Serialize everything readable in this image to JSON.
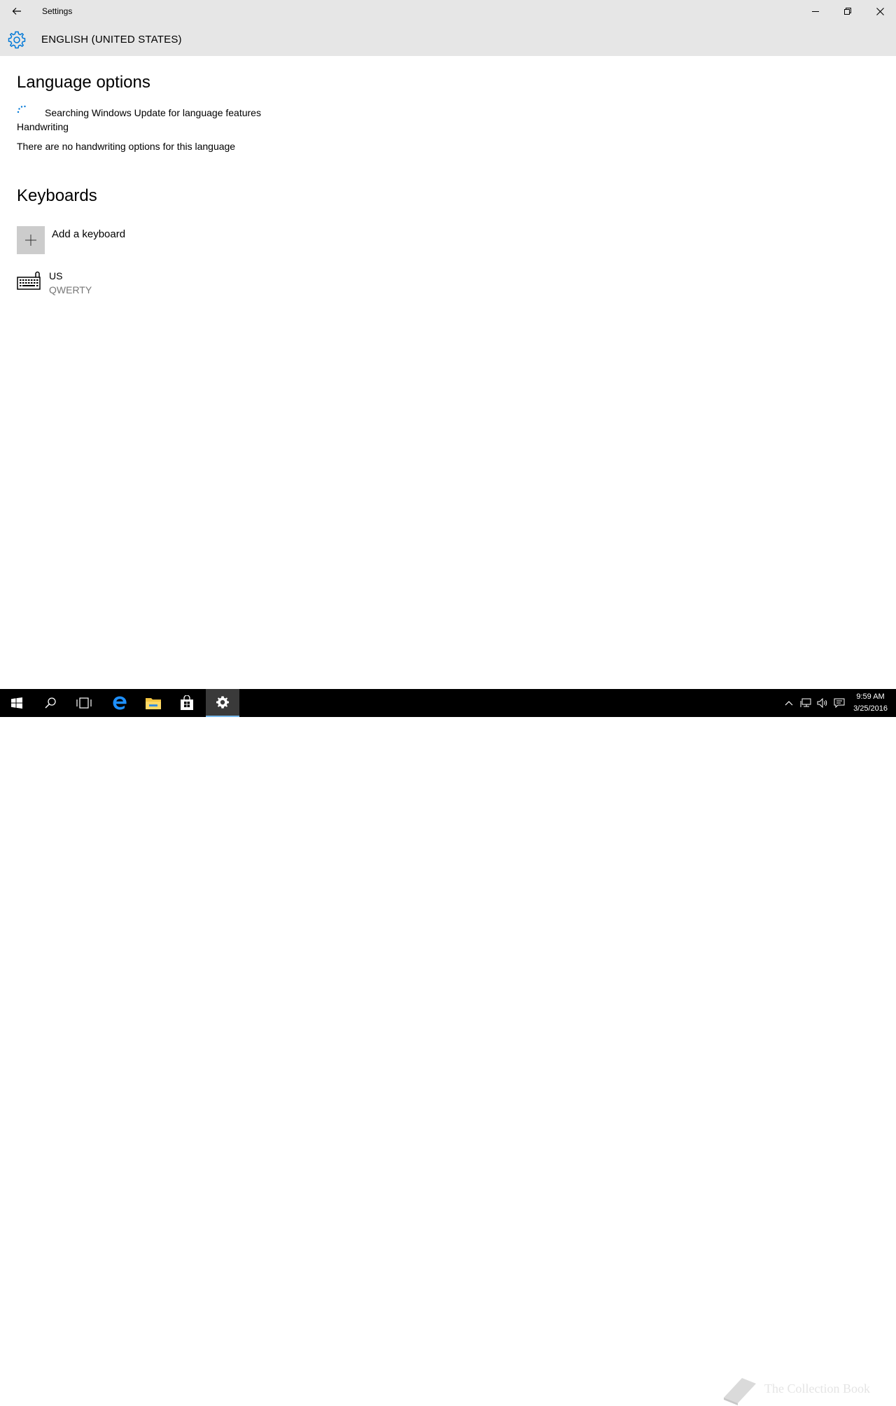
{
  "window": {
    "title": "Settings"
  },
  "header": {
    "title": "ENGLISH (UNITED STATES)"
  },
  "language_options": {
    "heading": "Language options",
    "searching_text": "Searching Windows Update for language features",
    "handwriting_label": "Handwriting",
    "handwriting_desc": "There are no handwriting options for this language"
  },
  "keyboards": {
    "heading": "Keyboards",
    "add_label": "Add a keyboard",
    "items": [
      {
        "name": "US",
        "layout": "QWERTY"
      }
    ]
  },
  "taskbar": {
    "apps": [
      "start-icon",
      "search-icon",
      "task-view-icon",
      "edge-icon",
      "file-explorer-icon",
      "store-icon",
      "settings-icon"
    ],
    "active_app": "settings-icon"
  },
  "watermark": {
    "text": "The Collection Book"
  },
  "clock": {
    "time": "9:59 AM",
    "date": "3/25/2016"
  },
  "colors": {
    "accent": "#0078d7",
    "titlebar_bg": "#e6e6e6",
    "taskbar_bg": "#000000"
  }
}
